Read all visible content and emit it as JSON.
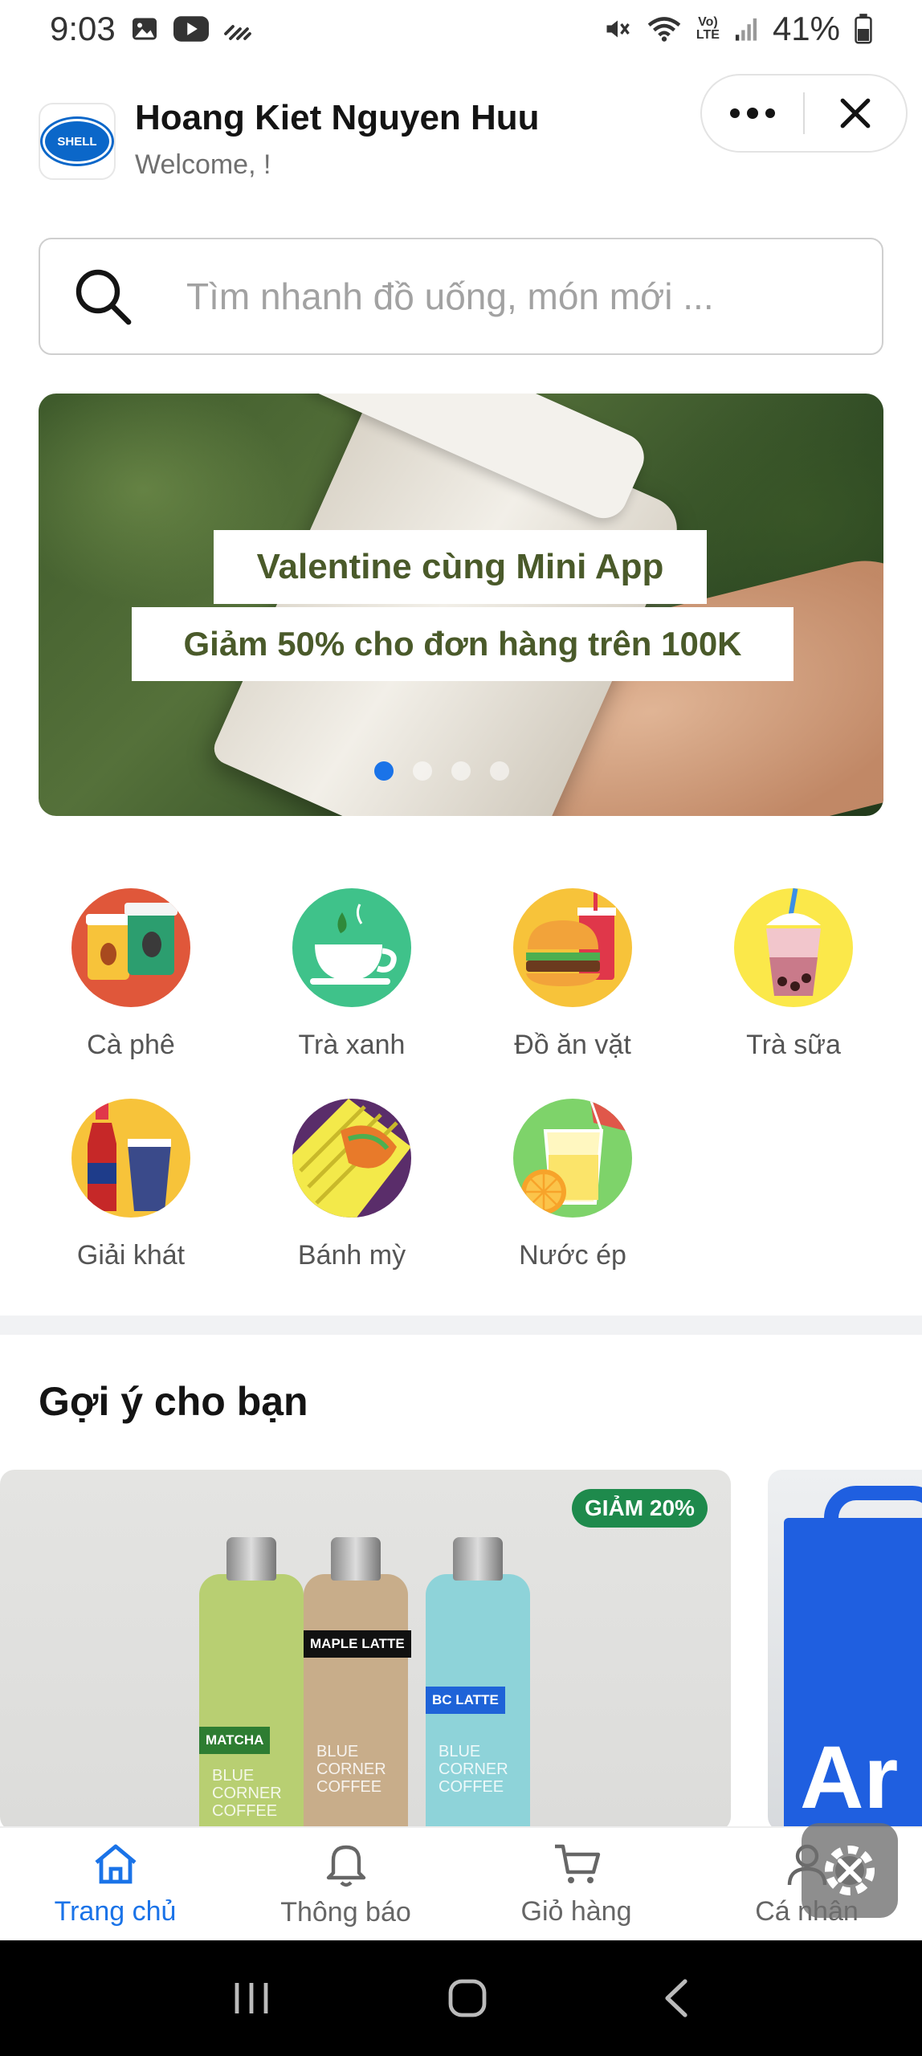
{
  "status_bar": {
    "time": "9:03",
    "battery": "41%",
    "icons_left": [
      "image-icon",
      "youtube-icon",
      "signal-waves-icon"
    ],
    "icons_right": [
      "mute-icon",
      "wifi-icon",
      "volte-icon",
      "cell-signal-icon",
      "battery-icon"
    ],
    "volte_top": "Vo)",
    "volte_bottom": "LTE"
  },
  "header": {
    "logo_text": "SHELL",
    "user_name": "Hoang Kiet Nguyen Huu",
    "welcome": "Welcome, !"
  },
  "search": {
    "placeholder": "Tìm nhanh đồ uống, món mới ..."
  },
  "banner": {
    "line1": "Valentine cùng Mini App",
    "line2": "Giảm 50% cho đơn hàng trên 100K",
    "slide_count": 4,
    "active_slide": 1
  },
  "categories": [
    {
      "label": "Cà phê",
      "icon": "coffee-icon"
    },
    {
      "label": "Trà xanh",
      "icon": "green-tea-icon"
    },
    {
      "label": "Đồ ăn vặt",
      "icon": "snack-icon"
    },
    {
      "label": "Trà sữa",
      "icon": "milk-tea-icon"
    },
    {
      "label": "Giải khát",
      "icon": "soft-drink-icon"
    },
    {
      "label": "Bánh mỳ",
      "icon": "bread-icon"
    },
    {
      "label": "Nước ép",
      "icon": "juice-icon"
    }
  ],
  "suggestions": {
    "title": "Gợi ý cho bạn",
    "products": [
      {
        "badge": "GIẢM 20%",
        "bottle_labels": [
          "MATCHA",
          "MAPLE LATTE",
          "BC LATTE"
        ],
        "brand_text": "BLUE CORNER COFFEE"
      }
    ],
    "second_card_text": "Ar"
  },
  "bottom_nav": {
    "items": [
      {
        "label": "Trang chủ",
        "icon": "home-icon",
        "active": true
      },
      {
        "label": "Thông báo",
        "icon": "bell-icon",
        "active": false
      },
      {
        "label": "Giỏ hàng",
        "icon": "cart-icon",
        "active": false
      },
      {
        "label": "Cá nhân",
        "icon": "user-icon",
        "active": false
      }
    ]
  },
  "colors": {
    "accent": "#1a73e8",
    "badge": "#1e8a4c",
    "text_primary": "#141414",
    "text_secondary": "#707070"
  }
}
